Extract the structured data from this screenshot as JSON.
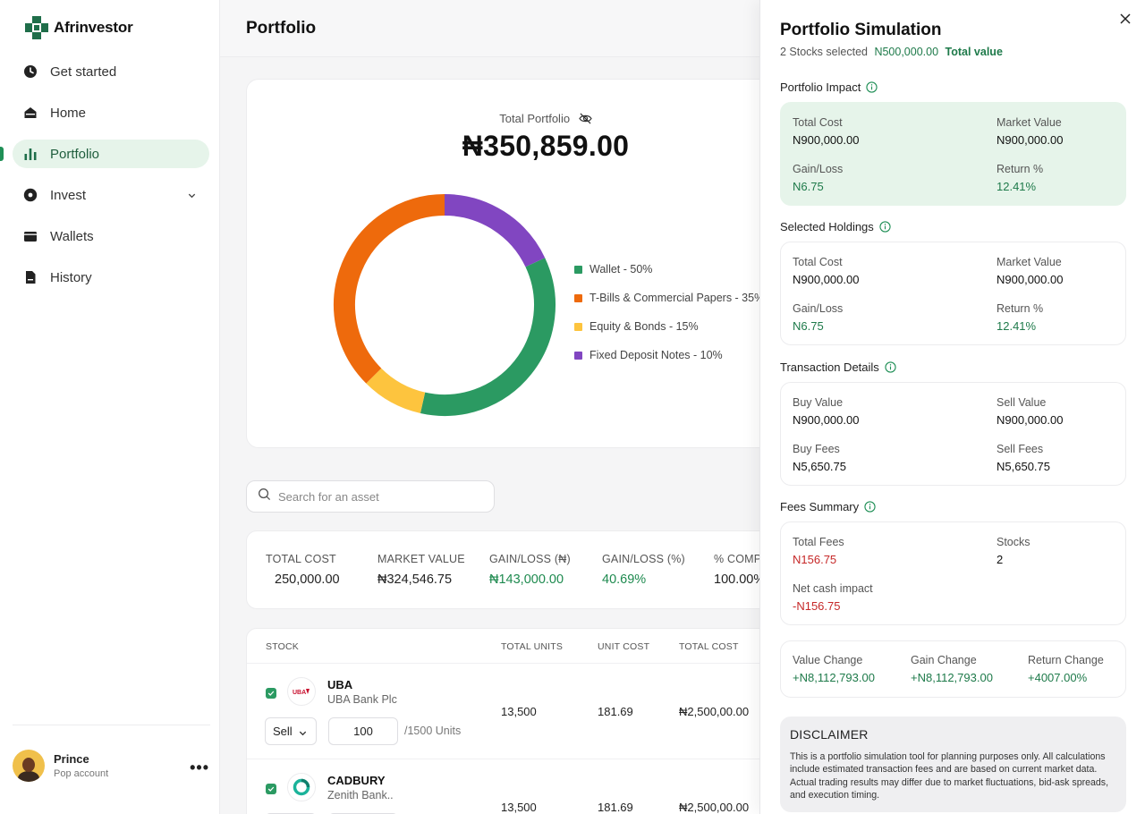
{
  "brand": {
    "name": "Afrinvestor"
  },
  "nav": {
    "items": [
      {
        "label": "Get started",
        "icon": "pie-clock-icon"
      },
      {
        "label": "Home",
        "icon": "home-icon"
      },
      {
        "label": "Portfolio",
        "icon": "bar-chart-icon",
        "active": true
      },
      {
        "label": "Invest",
        "icon": "plus-circle-icon",
        "has_dropdown": true
      },
      {
        "label": "Wallets",
        "icon": "wallet-icon"
      },
      {
        "label": "History",
        "icon": "document-icon"
      }
    ]
  },
  "user": {
    "name": "Prince",
    "subtitle": "Pop account"
  },
  "page": {
    "title": "Portfolio"
  },
  "portfolio": {
    "total_label": "Total Portfolio",
    "total_value": "₦350,859.00",
    "legend": [
      {
        "label": "Wallet - 50%",
        "color": "#2b9a62"
      },
      {
        "label": "T-Bills & Commercial  Papers - 35%",
        "color": "#ee6a0c"
      },
      {
        "label": "Equity & Bonds - 15%",
        "color": "#fdc43e"
      },
      {
        "label": "Fixed Deposit Notes - 10%",
        "color": "#8146c1"
      }
    ]
  },
  "chart_data": {
    "type": "pie",
    "categories": [
      "Wallet",
      "T-Bills & Commercial  Papers",
      "Equity & Bonds",
      "Fixed Deposit Notes"
    ],
    "values": [
      50,
      35,
      15,
      10
    ],
    "drawn_share": {
      "Fixed Deposit Notes": 0.18,
      "Wallet": 0.355,
      "Equity & Bonds": 0.09,
      "T-Bills & Commercial  Papers": 0.375
    },
    "colors": [
      "#2b9a62",
      "#ee6a0c",
      "#fdc43e",
      "#8146c1"
    ]
  },
  "search": {
    "placeholder": "Search for an asset"
  },
  "summary": [
    {
      "label": "TOTAL COST",
      "value": "250,000.00",
      "tone": "normal"
    },
    {
      "label": "MARKET VALUE",
      "value": "₦324,546.75",
      "tone": "normal"
    },
    {
      "label": "GAIN/LOSS (₦)",
      "value": "₦143,000.00",
      "tone": "green"
    },
    {
      "label": "GAIN/LOSS (%)",
      "value": "40.69%",
      "tone": "green"
    },
    {
      "label": "% COMP",
      "value": "100.00%",
      "tone": "normal"
    }
  ],
  "table": {
    "headers": [
      "STOCK",
      "TOTAL UNITS",
      "UNIT COST",
      "TOTAL COST"
    ],
    "rows": [
      {
        "ticker": "UBA",
        "name": "UBA Bank Plc",
        "units": "13,500",
        "unit_cost": "181.69",
        "total_cost": "₦2,500,00.00",
        "action": "Sell",
        "qty": "100",
        "available": "/1500 Units"
      },
      {
        "ticker": "CADBURY",
        "name": "Zenith Bank..",
        "units": "13,500",
        "unit_cost": "181.69",
        "total_cost": "₦2,500,00.00"
      }
    ]
  },
  "panel": {
    "title": "Portfolio Simulation",
    "selected": "2 Stocks selected",
    "amount": "N500,000.00",
    "total_value_label": "Total value",
    "impact": {
      "title": "Portfolio Impact",
      "total_cost_label": "Total Cost",
      "total_cost": "N900,000.00",
      "market_value_label": "Market Value",
      "market_value": "N900,000.00",
      "gain_label": "Gain/Loss",
      "gain": "N6.75",
      "return_label": "Return %",
      "return": "12.41%"
    },
    "holdings": {
      "title": "Selected Holdings",
      "total_cost_label": "Total Cost",
      "total_cost": "N900,000.00",
      "market_value_label": "Market Value",
      "market_value": "N900,000.00",
      "gain_label": "Gain/Loss",
      "gain": "N6.75",
      "return_label": "Return %",
      "return": "12.41%"
    },
    "transaction": {
      "title": "Transaction Details",
      "buy_value_label": "Buy Value",
      "buy_value": "N900,000.00",
      "sell_value_label": "Sell Value",
      "sell_value": "N900,000.00",
      "buy_fees_label": "Buy Fees",
      "buy_fees": "N5,650.75",
      "sell_fees_label": "Sell Fees",
      "sell_fees": "N5,650.75"
    },
    "fees": {
      "title": "Fees Summary",
      "total_fees_label": "Total Fees",
      "total_fees": "N156.75",
      "stocks_label": "Stocks",
      "stocks": "2",
      "net_cash_label": "Net cash impact",
      "net_cash": "-N156.75"
    },
    "changes": {
      "value_label": "Value Change",
      "value": "+N8,112,793.00",
      "gain_label": "Gain Change",
      "gain": "+N8,112,793.00",
      "return_label": "Return Change",
      "return": "+4007.00%"
    },
    "disclaimer": {
      "title": "DISCLAIMER",
      "text": "This is a portfolio simulation tool for planning purposes only. All calculations include estimated transaction fees and are based on current market data. Actual trading results may differ due to market fluctuations, bid-ask spreads, and execution timing."
    }
  }
}
